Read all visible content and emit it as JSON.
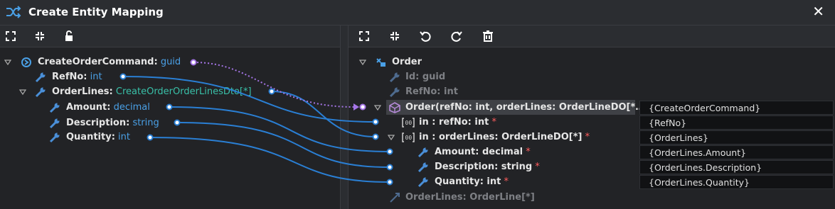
{
  "window": {
    "title": "Create Entity Mapping",
    "close_glyph": "✕"
  },
  "left_toolbar": [
    "expand-all",
    "collapse-all",
    "unlock"
  ],
  "right_toolbar": [
    "expand-all",
    "collapse-all",
    "undo",
    "redo",
    "delete"
  ],
  "source_tree": {
    "root": {
      "name": "CreateOrderCommand",
      "sep": ":",
      "type": "guid"
    },
    "items": [
      {
        "name": "RefNo",
        "type": "int"
      },
      {
        "name": "OrderLines",
        "type": "CreateOrderOrderLinesDto[*]"
      },
      {
        "name": "Amount",
        "type": "decimal"
      },
      {
        "name": "Description",
        "type": "string"
      },
      {
        "name": "Quantity",
        "type": "int"
      }
    ]
  },
  "target_tree": {
    "root": {
      "name": "Order"
    },
    "id": "Id: guid",
    "refno": "RefNo: int",
    "ctor": "Order(refNo: int, orderLines: OrderLineDO[*…",
    "param_refno": "in : refNo: int",
    "param_orderlines": "in : orderLines: OrderLineDO[*]",
    "amount": "Amount: decimal",
    "description": "Description: string",
    "quantity": "Quantity: int",
    "req_marker": "*",
    "orderlines_assoc": "OrderLines: OrderLine[*]"
  },
  "mappings": [
    "{CreateOrderCommand}",
    "{RefNo}",
    "{OrderLines}",
    "{OrderLines.Amount}",
    "{OrderLines.Description}",
    "{OrderLines.Quantity}"
  ],
  "colors": {
    "wire": "#2a7fd4",
    "wire_dotted": "#a575e6",
    "type": "#4aa0e6",
    "required": "#ff5d5d",
    "background": "#222326"
  }
}
